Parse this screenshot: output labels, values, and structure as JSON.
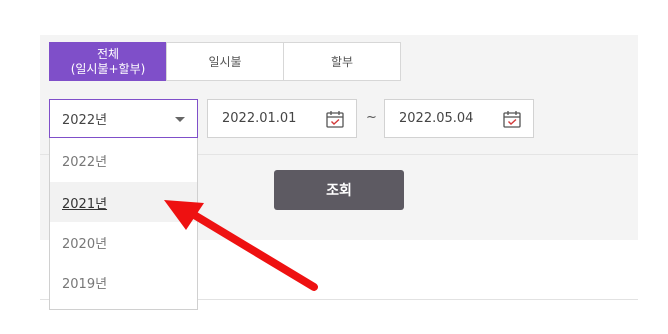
{
  "tabs": [
    {
      "label": "전체\n(일시불+할부)",
      "active": true
    },
    {
      "label": "일시불",
      "active": false
    },
    {
      "label": "할부",
      "active": false
    }
  ],
  "year_select": {
    "value": "2022년",
    "options": [
      "2022년",
      "2021년",
      "2020년",
      "2019년"
    ],
    "hovered": "2021년"
  },
  "date_from": {
    "value": "2022.01.01",
    "icon": "calendar-icon"
  },
  "separator": "~",
  "date_to": {
    "value": "2022.05.04",
    "icon": "calendar-icon"
  },
  "search_button": {
    "label": "조회"
  },
  "colors": {
    "accent": "#7f4fc9",
    "button": "#5d5a62",
    "annotation_arrow": "#ee1111"
  }
}
